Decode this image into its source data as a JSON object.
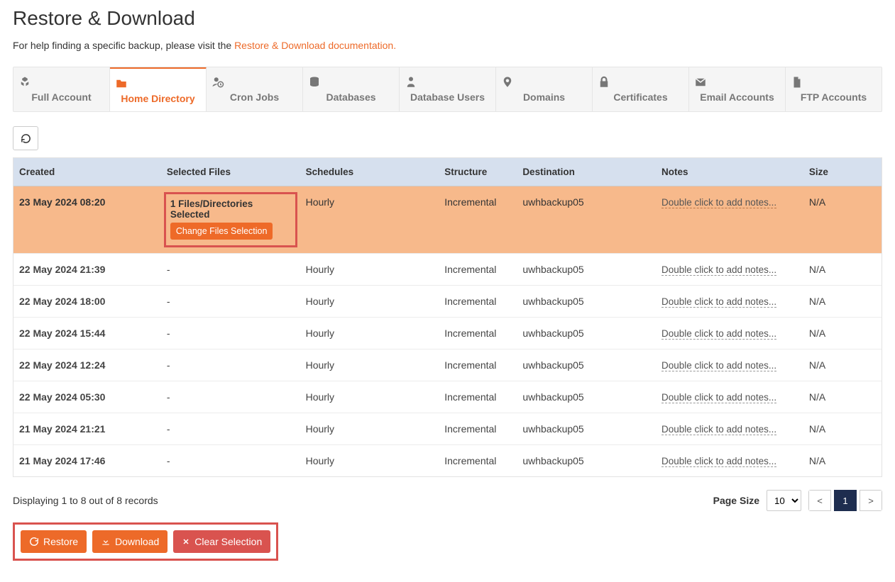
{
  "page": {
    "title": "Restore & Download",
    "help_prefix": "For help finding a specific backup, please visit the ",
    "help_link": "Restore & Download documentation."
  },
  "tabs": [
    {
      "label": "Full Account",
      "icon": "cubes"
    },
    {
      "label": "Home Directory",
      "icon": "folder",
      "active": true
    },
    {
      "label": "Cron Jobs",
      "icon": "user-clock"
    },
    {
      "label": "Databases",
      "icon": "database"
    },
    {
      "label": "Database Users",
      "icon": "user-tie"
    },
    {
      "label": "Domains",
      "icon": "map-marker"
    },
    {
      "label": "Certificates",
      "icon": "lock"
    },
    {
      "label": "Email Accounts",
      "icon": "envelope"
    },
    {
      "label": "FTP Accounts",
      "icon": "file"
    }
  ],
  "columns": {
    "created": "Created",
    "selected": "Selected Files",
    "schedules": "Schedules",
    "structure": "Structure",
    "destination": "Destination",
    "notes": "Notes",
    "size": "Size"
  },
  "selected_info": {
    "text": "1 Files/Directories Selected",
    "button": "Change Files Selection"
  },
  "notes_placeholder": "Double click to add notes...",
  "rows": [
    {
      "created": "23 May 2024 08:20",
      "schedules": "Hourly",
      "structure": "Incremental",
      "destination": "uwhbackup05",
      "size": "N/A",
      "highlight": true,
      "has_selection": true
    },
    {
      "created": "22 May 2024 21:39",
      "schedules": "Hourly",
      "structure": "Incremental",
      "destination": "uwhbackup05",
      "size": "N/A"
    },
    {
      "created": "22 May 2024 18:00",
      "schedules": "Hourly",
      "structure": "Incremental",
      "destination": "uwhbackup05",
      "size": "N/A"
    },
    {
      "created": "22 May 2024 15:44",
      "schedules": "Hourly",
      "structure": "Incremental",
      "destination": "uwhbackup05",
      "size": "N/A"
    },
    {
      "created": "22 May 2024 12:24",
      "schedules": "Hourly",
      "structure": "Incremental",
      "destination": "uwhbackup05",
      "size": "N/A"
    },
    {
      "created": "22 May 2024 05:30",
      "schedules": "Hourly",
      "structure": "Incremental",
      "destination": "uwhbackup05",
      "size": "N/A"
    },
    {
      "created": "21 May 2024 21:21",
      "schedules": "Hourly",
      "structure": "Incremental",
      "destination": "uwhbackup05",
      "size": "N/A"
    },
    {
      "created": "21 May 2024 17:46",
      "schedules": "Hourly",
      "structure": "Incremental",
      "destination": "uwhbackup05",
      "size": "N/A"
    }
  ],
  "status": "Displaying 1 to 8 out of 8 records",
  "pager": {
    "label": "Page Size",
    "size": "10",
    "prev": "<",
    "current": "1",
    "next": ">"
  },
  "actions": {
    "restore": "Restore",
    "download": "Download",
    "clear": "Clear Selection"
  }
}
